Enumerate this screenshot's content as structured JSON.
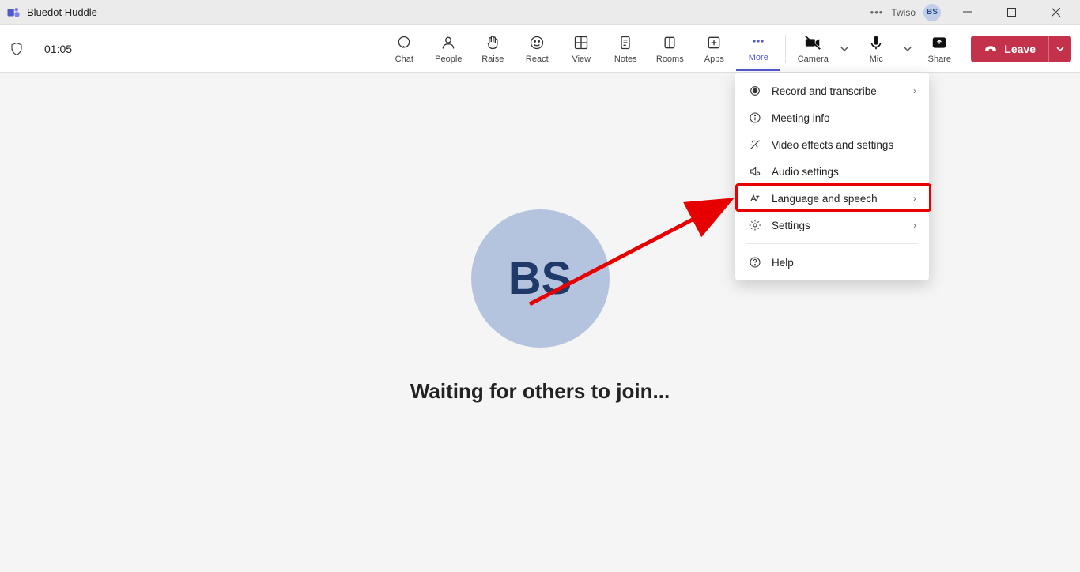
{
  "titlebar": {
    "title": "Bluedot Huddle",
    "user_name": "Twiso",
    "user_initials": "BS"
  },
  "meetbar": {
    "timer": "01:05",
    "tools": {
      "chat": "Chat",
      "people": "People",
      "raise": "Raise",
      "react": "React",
      "view": "View",
      "notes": "Notes",
      "rooms": "Rooms",
      "apps": "Apps",
      "more": "More",
      "camera": "Camera",
      "mic": "Mic",
      "share": "Share"
    },
    "leave_label": "Leave"
  },
  "main": {
    "avatar_initials": "BS",
    "waiting_text": "Waiting for others to join..."
  },
  "dropdown": {
    "items": {
      "record": "Record and transcribe",
      "meeting_info": "Meeting info",
      "video_effects": "Video effects and settings",
      "audio_settings": "Audio settings",
      "language": "Language and speech",
      "settings": "Settings",
      "help": "Help"
    }
  }
}
